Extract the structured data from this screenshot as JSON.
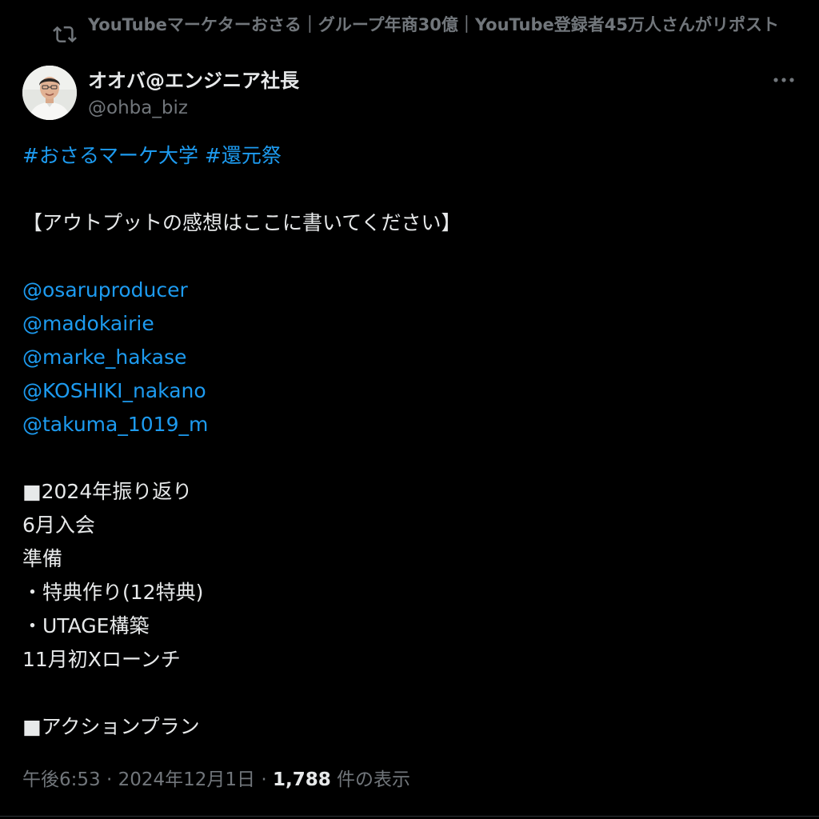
{
  "repost": {
    "text": "YouTubeマーケターおさる｜グループ年商30億｜YouTube登録者45万人さんがリポスト",
    "icon": "repost-icon"
  },
  "author": {
    "display_name": "オオバ@エンジニア社長",
    "handle": "@ohba_biz",
    "avatar_icon": "avatar-photo",
    "more_icon": "more-icon"
  },
  "tweet": {
    "hashtag_1": "#おさるマーケ大学",
    "hashtag_2": "#還元祭",
    "request": "【アウトプットの感想はここに書いてください】",
    "mentions": [
      "@osaruproducer",
      "@madokairie",
      "@marke_hakase",
      "@KOSHIKI_nakano",
      "@takuma_1019_m"
    ],
    "review_heading": "■2024年振り返り",
    "review_lines": [
      "6月入会",
      "準備",
      "・特典作り(12特典)",
      "・UTAGE構築",
      "11月初Xローンチ"
    ],
    "action_heading": "■アクションプラン"
  },
  "meta": {
    "time": "午後6:53",
    "separator": " · ",
    "date": "2024年12月1日",
    "views_count": "1,788",
    "views_label": " 件の表示"
  },
  "colors": {
    "background": "#000000",
    "text": "#e7e9ea",
    "secondary": "#71767b",
    "link": "#1d9bf0"
  }
}
